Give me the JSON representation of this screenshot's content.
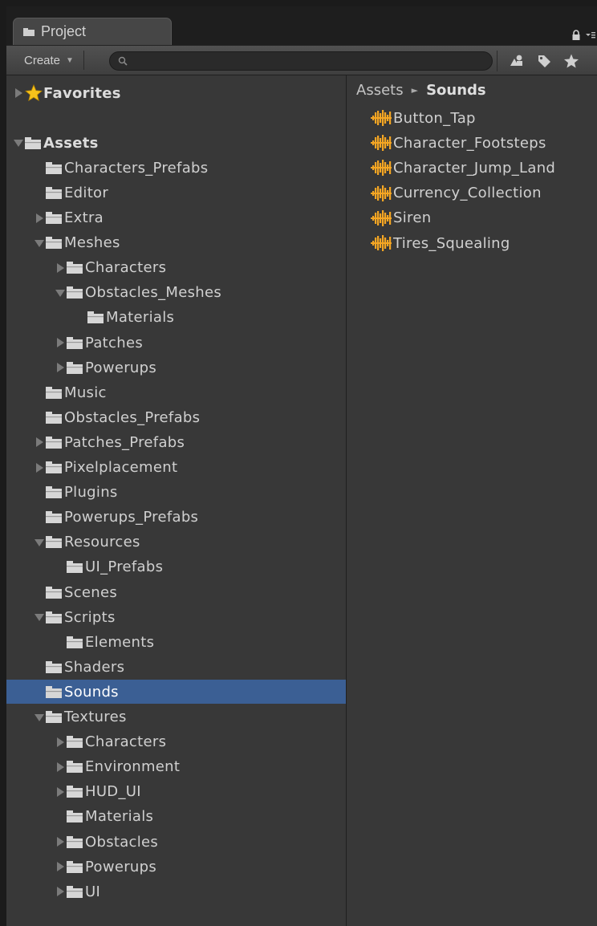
{
  "window": {
    "tab_title": "Project"
  },
  "toolbar": {
    "create_label": "Create",
    "search_placeholder": "",
    "search_value": ""
  },
  "tree": [
    {
      "label": "Favorites",
      "depth": 0,
      "arrow": "collapsed",
      "icon": "star-icon",
      "bold": true
    },
    {
      "label": "",
      "depth": 0,
      "arrow": "none",
      "icon": "none",
      "spacer": true
    },
    {
      "label": "Assets",
      "depth": 0,
      "arrow": "expanded",
      "icon": "folder-icon",
      "bold": true
    },
    {
      "label": "Characters_Prefabs",
      "depth": 1,
      "arrow": "none",
      "icon": "folder-icon"
    },
    {
      "label": "Editor",
      "depth": 1,
      "arrow": "none",
      "icon": "folder-icon"
    },
    {
      "label": "Extra",
      "depth": 1,
      "arrow": "collapsed",
      "icon": "folder-icon"
    },
    {
      "label": "Meshes",
      "depth": 1,
      "arrow": "expanded",
      "icon": "folder-icon"
    },
    {
      "label": "Characters",
      "depth": 2,
      "arrow": "collapsed",
      "icon": "folder-icon"
    },
    {
      "label": "Obstacles_Meshes",
      "depth": 2,
      "arrow": "expanded",
      "icon": "folder-icon"
    },
    {
      "label": "Materials",
      "depth": 3,
      "arrow": "none",
      "icon": "folder-icon"
    },
    {
      "label": "Patches",
      "depth": 2,
      "arrow": "collapsed",
      "icon": "folder-icon"
    },
    {
      "label": "Powerups",
      "depth": 2,
      "arrow": "collapsed",
      "icon": "folder-icon"
    },
    {
      "label": "Music",
      "depth": 1,
      "arrow": "none",
      "icon": "folder-icon"
    },
    {
      "label": "Obstacles_Prefabs",
      "depth": 1,
      "arrow": "none",
      "icon": "folder-icon"
    },
    {
      "label": "Patches_Prefabs",
      "depth": 1,
      "arrow": "collapsed",
      "icon": "folder-icon"
    },
    {
      "label": "Pixelplacement",
      "depth": 1,
      "arrow": "collapsed",
      "icon": "folder-icon"
    },
    {
      "label": "Plugins",
      "depth": 1,
      "arrow": "none",
      "icon": "folder-icon"
    },
    {
      "label": "Powerups_Prefabs",
      "depth": 1,
      "arrow": "none",
      "icon": "folder-icon"
    },
    {
      "label": "Resources",
      "depth": 1,
      "arrow": "expanded",
      "icon": "folder-icon"
    },
    {
      "label": "UI_Prefabs",
      "depth": 2,
      "arrow": "none",
      "icon": "folder-icon"
    },
    {
      "label": "Scenes",
      "depth": 1,
      "arrow": "none",
      "icon": "folder-icon"
    },
    {
      "label": "Scripts",
      "depth": 1,
      "arrow": "expanded",
      "icon": "folder-icon"
    },
    {
      "label": "Elements",
      "depth": 2,
      "arrow": "none",
      "icon": "folder-icon"
    },
    {
      "label": "Shaders",
      "depth": 1,
      "arrow": "none",
      "icon": "folder-icon"
    },
    {
      "label": "Sounds",
      "depth": 1,
      "arrow": "none",
      "icon": "folder-icon",
      "selected": true
    },
    {
      "label": "Textures",
      "depth": 1,
      "arrow": "expanded",
      "icon": "folder-icon"
    },
    {
      "label": "Characters",
      "depth": 2,
      "arrow": "collapsed",
      "icon": "folder-icon"
    },
    {
      "label": "Environment",
      "depth": 2,
      "arrow": "collapsed",
      "icon": "folder-icon"
    },
    {
      "label": "HUD_UI",
      "depth": 2,
      "arrow": "collapsed",
      "icon": "folder-icon"
    },
    {
      "label": "Materials",
      "depth": 2,
      "arrow": "none",
      "icon": "folder-icon"
    },
    {
      "label": "Obstacles",
      "depth": 2,
      "arrow": "collapsed",
      "icon": "folder-icon"
    },
    {
      "label": "Powerups",
      "depth": 2,
      "arrow": "collapsed",
      "icon": "folder-icon"
    },
    {
      "label": "UI",
      "depth": 2,
      "arrow": "collapsed",
      "icon": "folder-icon"
    }
  ],
  "breadcrumb": {
    "root": "Assets",
    "separator": "►",
    "current": "Sounds"
  },
  "files": [
    {
      "label": "Button_Tap",
      "icon": "audio-clip-icon"
    },
    {
      "label": "Character_Footsteps",
      "icon": "audio-clip-icon"
    },
    {
      "label": "Character_Jump_Land",
      "icon": "audio-clip-icon"
    },
    {
      "label": "Currency_Collection",
      "icon": "audio-clip-icon"
    },
    {
      "label": "Siren",
      "icon": "audio-clip-icon"
    },
    {
      "label": "Tires_Squealing",
      "icon": "audio-clip-icon"
    }
  ],
  "colors": {
    "panel_bg": "#383838",
    "selection": "#3b5f94",
    "audio_icon": "#f5a623",
    "star": "#f7c21b"
  }
}
